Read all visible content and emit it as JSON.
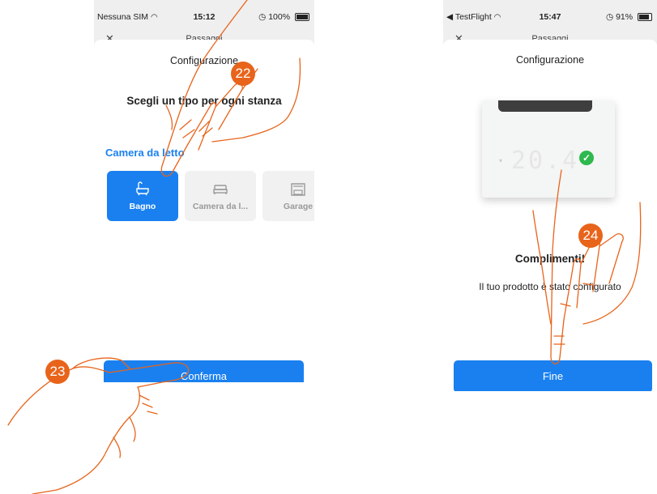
{
  "left_screen": {
    "status_bar": {
      "carrier": "Nessuna SIM",
      "time": "15:12",
      "battery": "100%"
    },
    "header_title": "Passaggi",
    "sheet_title": "Configurazione",
    "heading": "Scegli un tipo per ogni stanza",
    "section_label": "Camera da letto",
    "tiles": [
      {
        "label": "Bagno",
        "icon": "bathtub-icon",
        "selected": true
      },
      {
        "label": "Camera da l...",
        "icon": "bed-icon",
        "selected": false
      },
      {
        "label": "Garage",
        "icon": "garage-icon",
        "selected": false
      }
    ],
    "confirm_label": "Conferma"
  },
  "right_screen": {
    "status_bar": {
      "back_app": "TestFlight",
      "time": "15:47",
      "battery": "91%"
    },
    "header_title": "Passaggi",
    "sheet_title": "Configurazione",
    "device_display": "20.4",
    "congrats_title": "Complimenti!",
    "congrats_text": "Il tuo prodotto è stato configurato",
    "fine_label": "Fine"
  },
  "step_badges": [
    "22",
    "23",
    "24"
  ],
  "colors": {
    "accent": "#1a80f0",
    "badge": "#e8641b",
    "hand_outline": "#e8641b",
    "success": "#2eb84e"
  }
}
